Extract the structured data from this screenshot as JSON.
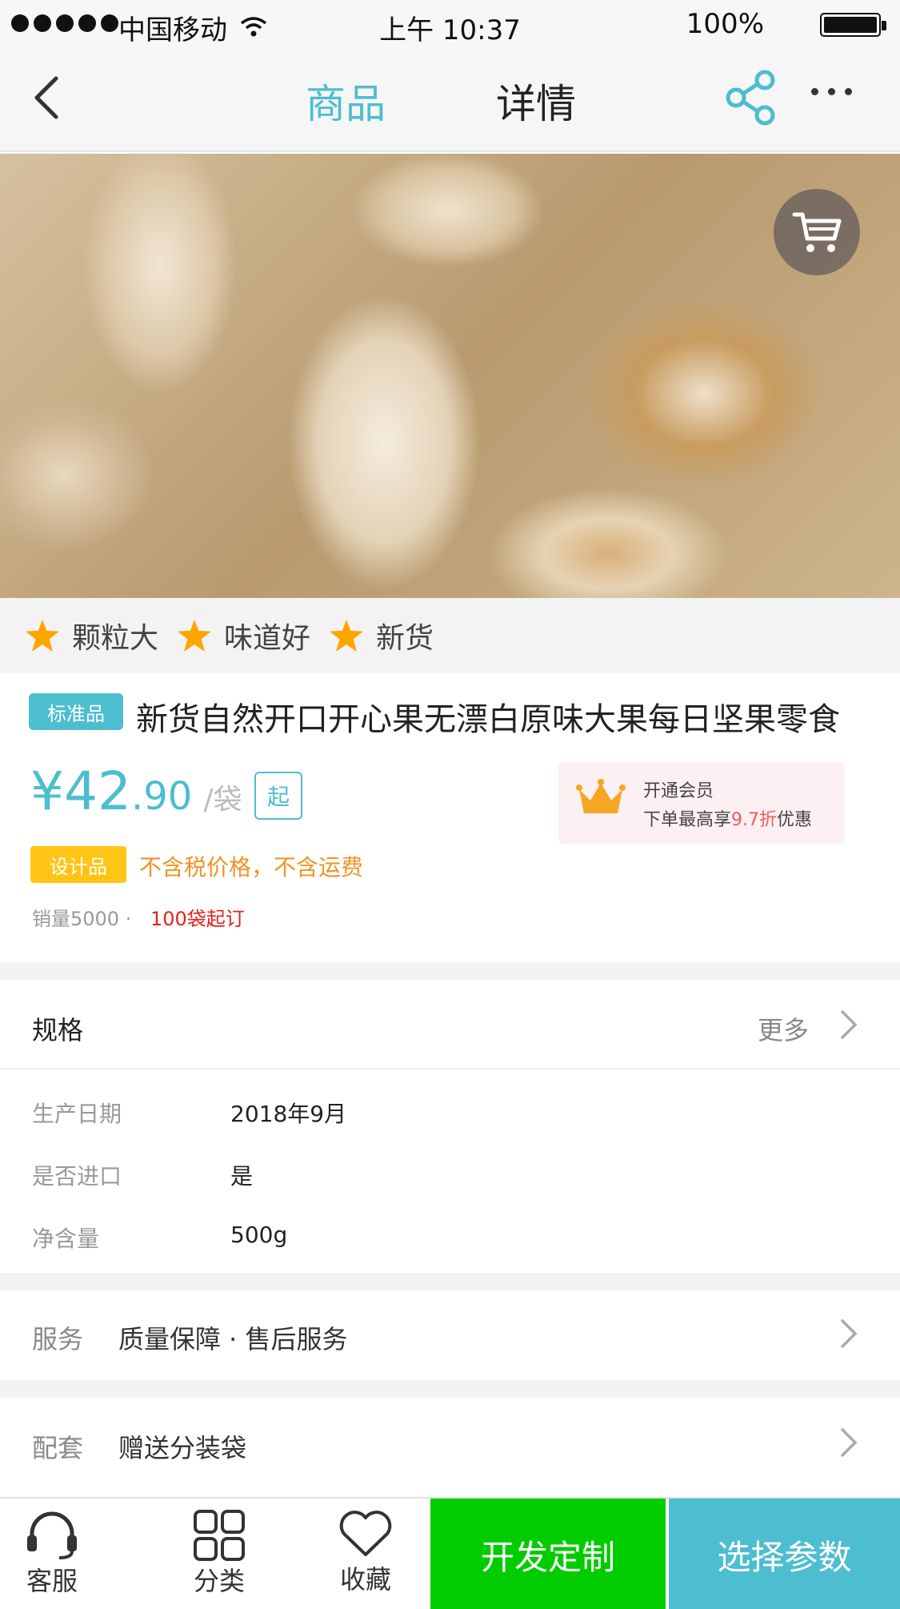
{
  "status_bar": {
    "carrier": "中国移动",
    "time": "上午 10:37",
    "battery": "100%",
    "battery_level": 1.0
  },
  "nav": {
    "tab_product": "商品",
    "tab_detail": "详情",
    "active_tab": "商品"
  },
  "product": {
    "tags": [
      "颗粒大",
      "味道好",
      "新货"
    ],
    "standard_badge": "标准品",
    "title": "新货自然开口开心果无漂白原味大果每日坚果零食",
    "price_currency": "¥",
    "price_int": "42",
    "price_dec": ".90",
    "price_unit": "/袋",
    "start_badge": "起",
    "vip_title": "开通会员",
    "vip_desc_prefix": "下单最高享",
    "vip_discount": "9.7折",
    "vip_desc_suffix": "优惠",
    "design_badge": "设计品",
    "tax_note": "不含税价格，不含运费",
    "sales": "销量5000 ·",
    "moq": "100袋起订"
  },
  "specs": {
    "title": "规格",
    "more": "更多",
    "rows": [
      {
        "key": "生产日期",
        "value": "2018年9月"
      },
      {
        "key": "是否进口",
        "value": "是"
      },
      {
        "key": "净含量",
        "value": "500g"
      }
    ]
  },
  "service": {
    "label": "服务",
    "value": "质量保障 ·   售后服务"
  },
  "accessory": {
    "label": "配套",
    "value": "赠送分装袋"
  },
  "bottom_bar": {
    "customer_service": "客服",
    "category": "分类",
    "favorite": "收藏",
    "customize": "开发定制",
    "select_params": "选择参数"
  },
  "colors": {
    "accent": "#4dbdd0",
    "green": "#00cc00",
    "orange": "#f29325",
    "red": "#e8201c",
    "star": "#ffa500",
    "gold": "#ffc415"
  }
}
